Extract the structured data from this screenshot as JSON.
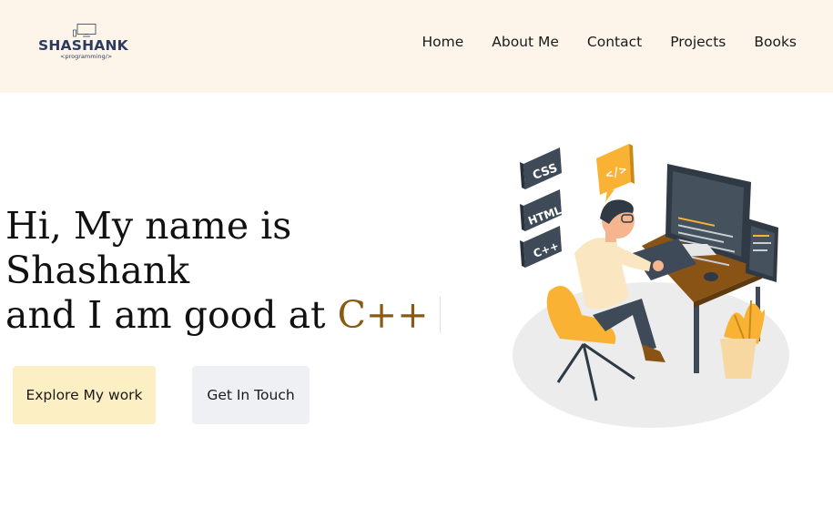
{
  "logo": {
    "name": "SHASHANK",
    "tagline": "<programming/>"
  },
  "nav": {
    "items": [
      {
        "label": "Home"
      },
      {
        "label": "About Me"
      },
      {
        "label": "Contact"
      },
      {
        "label": "Projects"
      },
      {
        "label": "Books"
      }
    ]
  },
  "hero": {
    "line1": "Hi, My name is",
    "line2": "Shashank",
    "line3_prefix": "and I am good at ",
    "skill": "C++",
    "accent_color": "#8a5a12"
  },
  "buttons": {
    "explore": "Explore My work",
    "contact": "Get In Touch"
  },
  "illustration": {
    "tags": [
      "CSS",
      "HTML",
      "C++"
    ],
    "code_icon": "</>"
  },
  "colors": {
    "header_bg": "#fdf5ea",
    "brand": "#2c3b5e",
    "primary_button": "#fcefc3",
    "secondary_button": "#eef0f3",
    "illustration_yellow": "#f9b233"
  }
}
